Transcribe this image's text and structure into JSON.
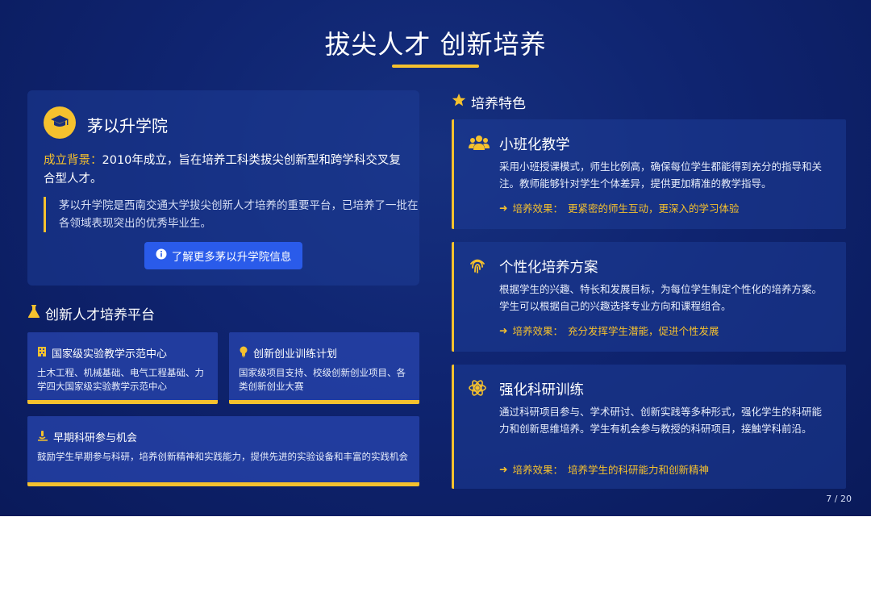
{
  "title": "拔尖人才 创新培养",
  "college": {
    "name": "茅以升学院",
    "background_label": "成立背景：",
    "background_text": "2010年成立，旨在培养工科类拔尖创新型和跨学科交叉复合型人才。",
    "quote": "茅以升学院是西南交通大学拔尖创新人才培养的重要平台，已培养了一批在各领域表现突出的优秀毕业生。",
    "button_label": "了解更多茅以升学院信息"
  },
  "platform": {
    "heading": "创新人才培养平台",
    "cards": [
      {
        "title": "国家级实验教学示范中心",
        "desc": "土木工程、机械基础、电气工程基础、力学四大国家级实验教学示范中心"
      },
      {
        "title": "创新创业训练计划",
        "desc": "国家级项目支持、校级创新创业项目、各类创新创业大赛"
      },
      {
        "title": "早期科研参与机会",
        "desc": "鼓励学生早期参与科研，培养创新精神和实践能力，提供先进的实验设备和丰富的实践机会"
      }
    ]
  },
  "features": {
    "heading": "培养特色",
    "effect_prefix": "培养效果：",
    "items": [
      {
        "title": "小班化教学",
        "desc": "采用小班授课模式，师生比例高，确保每位学生都能得到充分的指导和关注。教师能够针对学生个体差异，提供更加精准的教学指导。",
        "effect": "更紧密的师生互动，更深入的学习体验"
      },
      {
        "title": "个性化培养方案",
        "desc": "根据学生的兴趣、特长和发展目标，为每位学生制定个性化的培养方案。学生可以根据自己的兴趣选择专业方向和课程组合。",
        "effect": "充分发挥学生潜能，促进个性发展"
      },
      {
        "title": "强化科研训练",
        "desc": "通过科研项目参与、学术研讨、创新实践等多种形式，强化学生的科研能力和创新思维培养。学生有机会参与教授的科研项目，接触学科前沿。",
        "effect": "培养学生的科研能力和创新精神"
      }
    ]
  },
  "page_number": "7 / 20",
  "colors": {
    "accent": "#f5c12e",
    "background": "#0f2470",
    "button": "#2a5bea"
  }
}
